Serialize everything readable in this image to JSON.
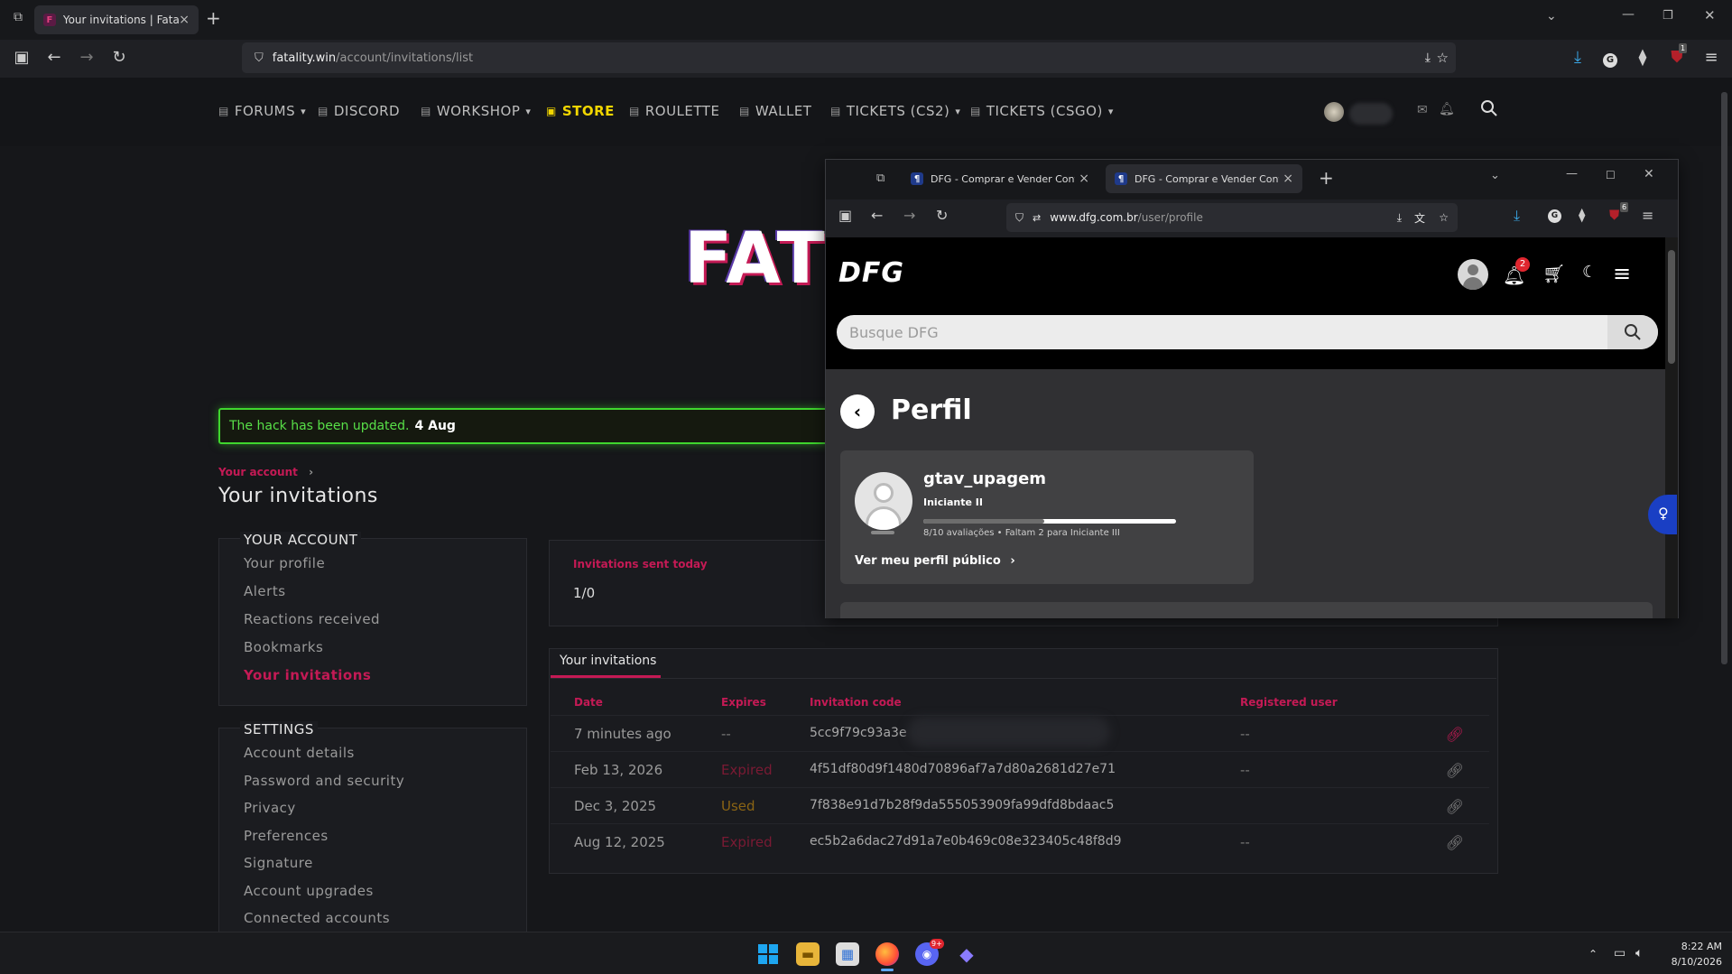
{
  "browser": {
    "tab_title": "Your invitations | Fatality",
    "url_host": "fatality.win",
    "url_path": "/account/invitations/list",
    "ext_badge": "1"
  },
  "site_nav": {
    "items": [
      {
        "label": "FORUMS",
        "icon": "forum-icon",
        "dropdown": true
      },
      {
        "label": "DISCORD",
        "icon": "discord-icon",
        "dropdown": false
      },
      {
        "label": "WORKSHOP",
        "icon": "workshop-icon",
        "dropdown": true
      },
      {
        "label": "STORE",
        "icon": "store-icon",
        "dropdown": false,
        "active": true
      },
      {
        "label": "ROULETTE",
        "icon": "roulette-icon",
        "dropdown": false
      },
      {
        "label": "WALLET",
        "icon": "wallet-icon",
        "dropdown": false
      },
      {
        "label": "TICKETS (CS2)",
        "icon": "ticket-icon",
        "dropdown": true
      },
      {
        "label": "TICKETS (CSGO)",
        "icon": "ticket-icon",
        "dropdown": true
      }
    ]
  },
  "logo": {
    "text": "FAT"
  },
  "notice": {
    "text": "The hack has been updated.",
    "date": "4 Aug"
  },
  "breadcrumb": {
    "label": "Your account"
  },
  "page_title": "Your invitations",
  "sidebar": {
    "account_heading": "YOUR ACCOUNT",
    "account_items": [
      "Your profile",
      "Alerts",
      "Reactions received",
      "Bookmarks",
      "Your invitations"
    ],
    "settings_heading": "SETTINGS",
    "settings_items": [
      "Account details",
      "Password and security",
      "Privacy",
      "Preferences",
      "Signature",
      "Account upgrades",
      "Connected accounts"
    ]
  },
  "stats": {
    "label": "Invitations sent today",
    "value": "1/0"
  },
  "invitations": {
    "tab_label": "Your invitations",
    "headers": {
      "date": "Date",
      "expires": "Expires",
      "code": "Invitation code",
      "user": "Registered user"
    },
    "rows": [
      {
        "date": "7 minutes ago",
        "expires": "--",
        "code": "5cc9f79c93a3e",
        "user": "--"
      },
      {
        "date": "Feb 13, 2026",
        "expires": "Expired",
        "code": "4f51df80d9f1480d70896af7a7d80a2681d27e71",
        "user": "--"
      },
      {
        "date": "Dec 3, 2025",
        "expires": "Used",
        "code": "7f838e91d7b28f9da555053909fa99dfd8bdaac5",
        "user": ""
      },
      {
        "date": "Aug 12, 2025",
        "expires": "Expired",
        "code": "ec5b2a6dac27d91a7e0b469c08e323405c48f8d9",
        "user": "--"
      }
    ]
  },
  "popup": {
    "tab1": "DFG - Comprar e Vender Conta",
    "tab2": "DFG - Comprar e Vender Conta",
    "url_host": "www.dfg.com.br",
    "url_path": "/user/profile",
    "brand": "DFG",
    "notif_count": "2",
    "search_placeholder": "Busque DFG",
    "page_title": "Perfil",
    "username": "gtav_upagem",
    "rank": "Iniciante II",
    "progress_fraction": 0.8,
    "progress_text": "8/10 avaliações • Faltam 2 para Iniciante III",
    "public_link": "Ver meu perfil público",
    "ext_badge": "6"
  },
  "taskbar": {
    "time": "8:22 AM",
    "date": "8/10/2026",
    "discord_badge": "9+"
  },
  "colors": {
    "accent": "#c41a55",
    "store": "#f2d600",
    "notice_border": "#3fd62e",
    "bg": "#16171a"
  }
}
